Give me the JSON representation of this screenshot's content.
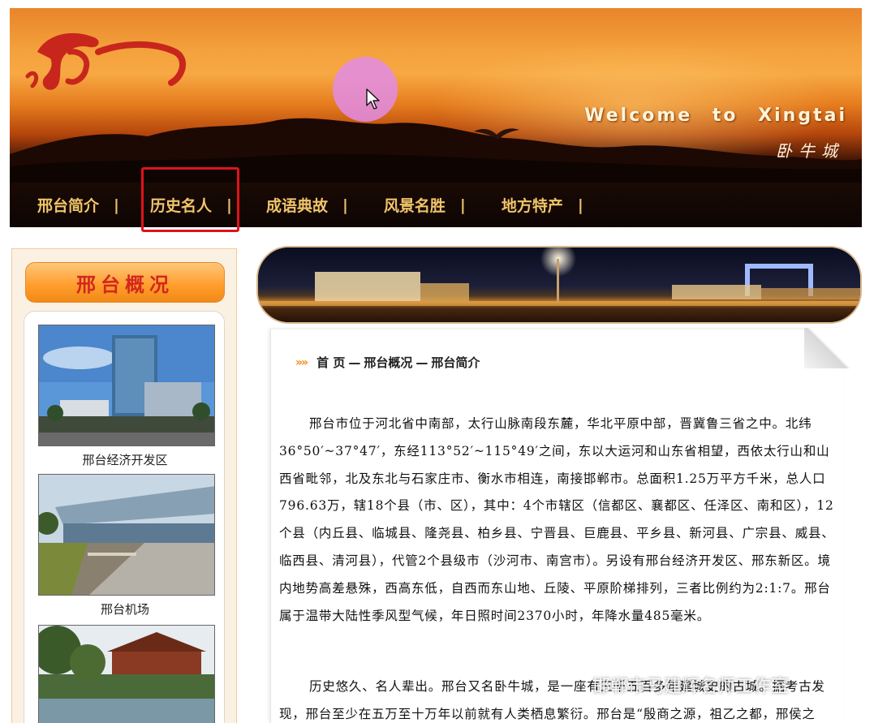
{
  "header": {
    "welcome_text": "Welcome to Xingtai",
    "subtitle": "卧牛城"
  },
  "nav": {
    "items": [
      {
        "label": "邢台简介"
      },
      {
        "label": "历史名人"
      },
      {
        "label": "成语典故"
      },
      {
        "label": "风景名胜"
      },
      {
        "label": "地方特产"
      }
    ],
    "separator": "|",
    "highlighted_item": "历史名人"
  },
  "sidebar": {
    "title": "邢台概况",
    "photos": [
      {
        "caption": "邢台经济开发区"
      },
      {
        "caption": "邢台机场"
      },
      {
        "caption": ""
      }
    ]
  },
  "main": {
    "breadcrumb": {
      "arrows": "»»",
      "home": "首 页",
      "level2": "邢台概况",
      "level3": "邢台简介",
      "sep": "—"
    },
    "paragraphs": [
      "邢台市位于河北省中南部，太行山脉南段东麓，华北平原中部，晋冀鲁三省之中。北纬36°50′~37°47′，东经113°52′~115°49′之间，东以大运河和山东省相望，西依太行山和山西省毗邻，北及东北与石家庄市、衡水市相连，南接邯郸市。总面积1.25万平方千米，总人口796.63万，辖18个县（市、区），其中：4个市辖区（信都区、襄都区、任泽区、南和区），12个县（内丘县、临城县、隆尧县、柏乡县、宁晋县、巨鹿县、平乡县、新河县、广宗县、威县、临西县、清河县），代管2个县级市（沙河市、南宫市）。另设有邢台经济开发区、邢东新区。境内地势高差悬殊，西高东低，自西而东山地、丘陵、平原阶梯排列，三者比例约为2:1:7。邢台属于温带大陆性季风型气候，年日照时间2370小时，年降水量485毫米。",
      "历史悠久、名人辈出。邢台又名卧牛城，是一座有三千五百多年建城史的古城。据考古发现，邢台至少在五万至十万年以前就有人类栖息繁衍。邢台是“殷商之源，祖乙之都，邢侯之"
    ]
  },
  "watermark": "邯郸市马建辉名师工作室"
}
